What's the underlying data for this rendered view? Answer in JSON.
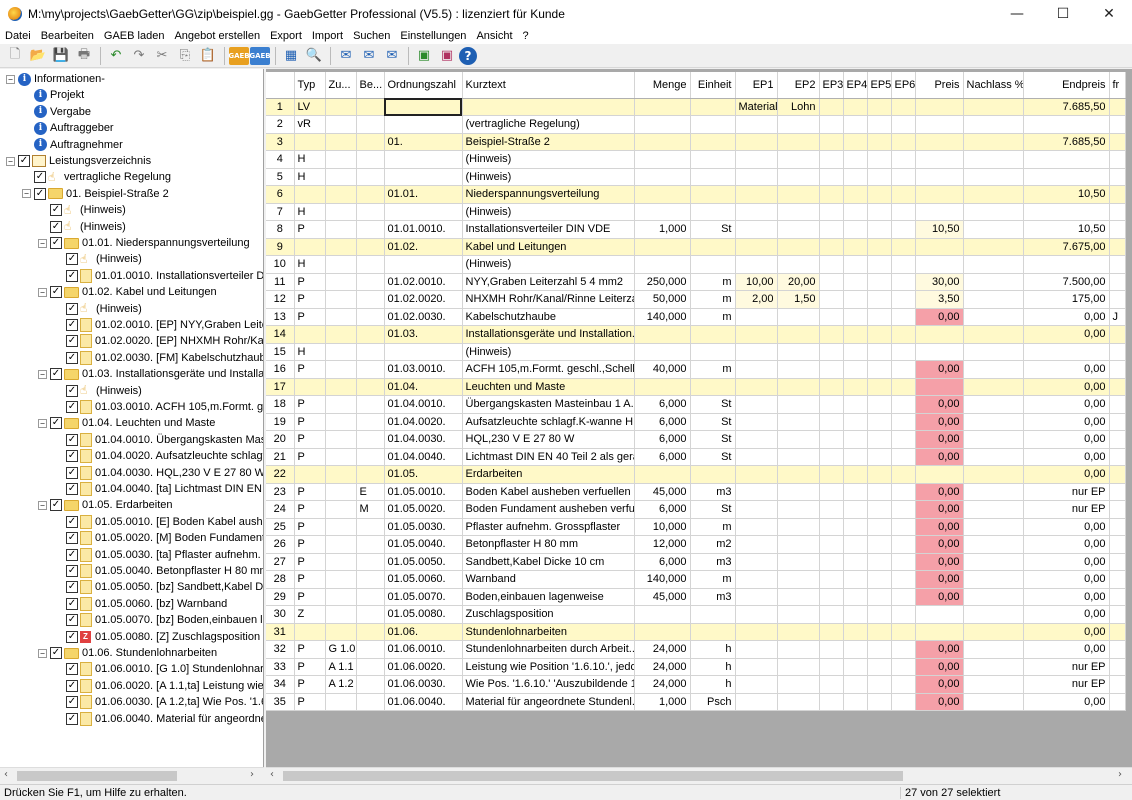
{
  "window": {
    "title": "M:\\my\\projects\\GaebGetter\\GG\\zip\\beispiel.gg - GaebGetter Professional (V5.5) : lizenziert für Kunde",
    "minimize": "—",
    "maximize": "☐",
    "close": "✕"
  },
  "menu": [
    "Datei",
    "Bearbeiten",
    "GAEB laden",
    "Angebot erstellen",
    "Export",
    "Import",
    "Suchen",
    "Einstellungen",
    "Ansicht",
    "?"
  ],
  "toolbar": {
    "icons": [
      "new-file-icon",
      "open-folder-icon",
      "save-icon",
      "print-icon",
      "undo-icon",
      "redo-icon",
      "cut-icon",
      "copy-icon",
      "paste-icon",
      "gaeb-import-icon",
      "gaeb-export-icon",
      "grid-view-icon",
      "search-icon",
      "mail-icon",
      "mail-export-icon",
      "mail-attach-icon",
      "calc-icon",
      "calc2-icon",
      "help-icon"
    ],
    "gaeb_label": "GAEB"
  },
  "tree": [
    {
      "level": 0,
      "exp": "−",
      "icon": "info",
      "label": "Informationen-"
    },
    {
      "level": 1,
      "icon": "info",
      "label": "Projekt"
    },
    {
      "level": 1,
      "icon": "info",
      "label": "Vergabe"
    },
    {
      "level": 1,
      "icon": "info",
      "label": "Auftraggeber"
    },
    {
      "level": 1,
      "icon": "info",
      "label": "Auftragnehmer"
    },
    {
      "level": 0,
      "exp": "−",
      "cb": true,
      "icon": "book",
      "label": "Leistungsverzeichnis"
    },
    {
      "level": 1,
      "cb": true,
      "icon": "hand",
      "label": "vertragliche Regelung"
    },
    {
      "level": 1,
      "exp": "−",
      "cb": true,
      "icon": "folder",
      "label": "01. Beispiel-Straße 2"
    },
    {
      "level": 2,
      "cb": true,
      "icon": "hand",
      "label": "(Hinweis)"
    },
    {
      "level": 2,
      "cb": true,
      "icon": "hand",
      "label": "(Hinweis)"
    },
    {
      "level": 2,
      "exp": "−",
      "cb": true,
      "icon": "folder",
      "label": "01.01. Niederspannungsverteilung"
    },
    {
      "level": 3,
      "cb": true,
      "icon": "hand",
      "label": "(Hinweis)"
    },
    {
      "level": 3,
      "cb": true,
      "icon": "doc",
      "label": "01.01.0010. Installationsverteiler DIN VDE"
    },
    {
      "level": 2,
      "exp": "−",
      "cb": true,
      "icon": "folder",
      "label": "01.02. Kabel und Leitungen"
    },
    {
      "level": 3,
      "cb": true,
      "icon": "hand",
      "label": "(Hinweis)"
    },
    {
      "level": 3,
      "cb": true,
      "icon": "doc",
      "label": "01.02.0010. [EP] NYY,Graben Leiterzahl"
    },
    {
      "level": 3,
      "cb": true,
      "icon": "doc",
      "label": "01.02.0020. [EP] NHXMH Rohr/Kanal"
    },
    {
      "level": 3,
      "cb": true,
      "icon": "doc",
      "label": "01.02.0030. [FM] Kabelschutzhaube"
    },
    {
      "level": 2,
      "exp": "−",
      "cb": true,
      "icon": "folder",
      "label": "01.03. Installationsgeräte und Installation"
    },
    {
      "level": 3,
      "cb": true,
      "icon": "hand",
      "label": "(Hinweis)"
    },
    {
      "level": 3,
      "cb": true,
      "icon": "doc",
      "label": "01.03.0010. ACFH 105,m.Formt. geschl."
    },
    {
      "level": 2,
      "exp": "−",
      "cb": true,
      "icon": "folder",
      "label": "01.04. Leuchten und Maste"
    },
    {
      "level": 3,
      "cb": true,
      "icon": "doc",
      "label": "01.04.0010. Übergangskasten Mastbau"
    },
    {
      "level": 3,
      "cb": true,
      "icon": "doc",
      "label": "01.04.0020. Aufsatzleuchte schlagf.K"
    },
    {
      "level": 3,
      "cb": true,
      "icon": "doc",
      "label": "01.04.0030. HQL,230 V E 27 80 W"
    },
    {
      "level": 3,
      "cb": true,
      "icon": "doc",
      "label": "01.04.0040. [ta] Lichtmast DIN EN 40"
    },
    {
      "level": 2,
      "exp": "−",
      "cb": true,
      "icon": "folder",
      "label": "01.05. Erdarbeiten"
    },
    {
      "level": 3,
      "cb": true,
      "icon": "doc",
      "label": "01.05.0010. [E] Boden Kabel ausheben"
    },
    {
      "level": 3,
      "cb": true,
      "icon": "doc",
      "label": "01.05.0020. [M] Boden Fundament aus"
    },
    {
      "level": 3,
      "cb": true,
      "icon": "doc",
      "label": "01.05.0030. [ta] Pflaster aufnehm. Gr"
    },
    {
      "level": 3,
      "cb": true,
      "icon": "doc",
      "label": "01.05.0040. Betonpflaster H 80 mm"
    },
    {
      "level": 3,
      "cb": true,
      "icon": "doc",
      "label": "01.05.0050. [bz] Sandbett,Kabel Dicke"
    },
    {
      "level": 3,
      "cb": true,
      "icon": "doc",
      "label": "01.05.0060. [bz] Warnband"
    },
    {
      "level": 3,
      "cb": true,
      "icon": "doc",
      "label": "01.05.0070. [bz] Boden,einbauen lag"
    },
    {
      "level": 3,
      "cb": true,
      "icon": "z",
      "label": "01.05.0080. [Z] Zuschlagsposition"
    },
    {
      "level": 2,
      "exp": "−",
      "cb": true,
      "icon": "folder",
      "label": "01.06. Stundenlohnarbeiten"
    },
    {
      "level": 3,
      "cb": true,
      "icon": "doc",
      "label": "01.06.0010. [G 1.0] Stundenlohnarbeiten"
    },
    {
      "level": 3,
      "cb": true,
      "icon": "doc",
      "label": "01.06.0020. [A 1.1,ta] Leistung wie P"
    },
    {
      "level": 3,
      "cb": true,
      "icon": "doc",
      "label": "01.06.0030. [A 1.2,ta] Wie Pos. '1.6.1"
    },
    {
      "level": 3,
      "cb": true,
      "icon": "doc",
      "label": "01.06.0040. Material für angeordnete"
    }
  ],
  "grid": {
    "columns": [
      "",
      "Typ",
      "Zu...",
      "Be...",
      "Ordnungszahl",
      "Kurztext",
      "Menge",
      "Einheit",
      "EP1",
      "EP2",
      "EP3",
      "EP4",
      "EP5",
      "EP6",
      "Preis",
      "Nachlass %",
      "Endpreis",
      "fr"
    ],
    "rows": [
      {
        "n": "1",
        "typ": "LV",
        "zu": "",
        "be": "",
        "oz": "",
        "kt": "",
        "menge": "",
        "einh": "",
        "ep1": "Material",
        "ep2": "Lohn",
        "preis": "",
        "end": "7.685,50",
        "group": true,
        "sel": true
      },
      {
        "n": "2",
        "typ": "vR",
        "zu": "",
        "be": "",
        "oz": "",
        "kt": "(vertragliche Regelung)",
        "menge": "",
        "einh": "",
        "ep1": "",
        "ep2": "",
        "preis": "",
        "end": ""
      },
      {
        "n": "3",
        "typ": "",
        "zu": "",
        "be": "",
        "oz": "01.",
        "kt": "Beispiel-Straße 2",
        "menge": "",
        "einh": "",
        "ep1": "",
        "ep2": "",
        "preis": "",
        "end": "7.685,50",
        "group": true
      },
      {
        "n": "4",
        "typ": "H",
        "zu": "",
        "be": "",
        "oz": "",
        "kt": "(Hinweis)",
        "menge": "",
        "einh": "",
        "ep1": "",
        "ep2": "",
        "preis": "",
        "end": ""
      },
      {
        "n": "5",
        "typ": "H",
        "zu": "",
        "be": "",
        "oz": "",
        "kt": "(Hinweis)",
        "menge": "",
        "einh": "",
        "ep1": "",
        "ep2": "",
        "preis": "",
        "end": ""
      },
      {
        "n": "6",
        "typ": "",
        "zu": "",
        "be": "",
        "oz": "01.01.",
        "kt": "Niederspannungsverteilung",
        "menge": "",
        "einh": "",
        "ep1": "",
        "ep2": "",
        "preis": "",
        "end": "10,50",
        "group": true
      },
      {
        "n": "7",
        "typ": "H",
        "zu": "",
        "be": "",
        "oz": "",
        "kt": "(Hinweis)",
        "menge": "",
        "einh": "",
        "ep1": "",
        "ep2": "",
        "preis": "",
        "end": ""
      },
      {
        "n": "8",
        "typ": "P",
        "zu": "",
        "be": "",
        "oz": "01.01.0010.",
        "kt": "Installationsverteiler DIN VDE",
        "menge": "1,000",
        "einh": "St",
        "ep1": "",
        "ep2": "",
        "preis": "10,50",
        "end": "10,50",
        "pale": true
      },
      {
        "n": "9",
        "typ": "",
        "zu": "",
        "be": "",
        "oz": "01.02.",
        "kt": "Kabel und Leitungen",
        "menge": "",
        "einh": "",
        "ep1": "",
        "ep2": "",
        "preis": "",
        "end": "7.675,00",
        "group": true
      },
      {
        "n": "10",
        "typ": "H",
        "zu": "",
        "be": "",
        "oz": "",
        "kt": "(Hinweis)",
        "menge": "",
        "einh": "",
        "ep1": "",
        "ep2": "",
        "preis": "",
        "end": ""
      },
      {
        "n": "11",
        "typ": "P",
        "zu": "",
        "be": "",
        "oz": "01.02.0010.",
        "kt": "NYY,Graben Leiterzahl 5 4 mm2",
        "menge": "250,000",
        "einh": "m",
        "ep1": "10,00",
        "ep2": "20,00",
        "preis": "30,00",
        "end": "7.500,00",
        "pale": true,
        "epale": true
      },
      {
        "n": "12",
        "typ": "P",
        "zu": "",
        "be": "",
        "oz": "01.02.0020.",
        "kt": "NHXMH Rohr/Kanal/Rinne Leiterza...",
        "menge": "50,000",
        "einh": "m",
        "ep1": "2,00",
        "ep2": "1,50",
        "preis": "3,50",
        "end": "175,00",
        "pale": true,
        "epale": true
      },
      {
        "n": "13",
        "typ": "P",
        "zu": "",
        "be": "",
        "oz": "01.02.0030.",
        "kt": "Kabelschutzhaube",
        "menge": "140,000",
        "einh": "m",
        "ep1": "",
        "ep2": "",
        "preis": "0,00",
        "end": "0,00",
        "pink": true,
        "fr": "J"
      },
      {
        "n": "14",
        "typ": "",
        "zu": "",
        "be": "",
        "oz": "01.03.",
        "kt": "Installationsgeräte und Installation...",
        "menge": "",
        "einh": "",
        "ep1": "",
        "ep2": "",
        "preis": "",
        "end": "0,00",
        "group": true
      },
      {
        "n": "15",
        "typ": "H",
        "zu": "",
        "be": "",
        "oz": "",
        "kt": "(Hinweis)",
        "menge": "",
        "einh": "",
        "ep1": "",
        "ep2": "",
        "preis": "",
        "end": ""
      },
      {
        "n": "16",
        "typ": "P",
        "zu": "",
        "be": "",
        "oz": "01.03.0010.",
        "kt": "ACFH 105,m.Formt. geschl.,Schelle...",
        "menge": "40,000",
        "einh": "m",
        "ep1": "",
        "ep2": "",
        "preis": "0,00",
        "end": "0,00",
        "pink": true
      },
      {
        "n": "17",
        "typ": "",
        "zu": "",
        "be": "",
        "oz": "01.04.",
        "kt": "Leuchten und Maste",
        "menge": "",
        "einh": "",
        "ep1": "",
        "ep2": "",
        "preis": "",
        "end": "0,00",
        "group": true,
        "pink": true
      },
      {
        "n": "18",
        "typ": "P",
        "zu": "",
        "be": "",
        "oz": "01.04.0010.",
        "kt": "Übergangskasten Masteinbau 1 A...",
        "menge": "6,000",
        "einh": "St",
        "ep1": "",
        "ep2": "",
        "preis": "0,00",
        "end": "0,00",
        "pink": true
      },
      {
        "n": "19",
        "typ": "P",
        "zu": "",
        "be": "",
        "oz": "01.04.0020.",
        "kt": "Aufsatzleuchte schlagf.K-wanne H...",
        "menge": "6,000",
        "einh": "St",
        "ep1": "",
        "ep2": "",
        "preis": "0,00",
        "end": "0,00",
        "pink": true
      },
      {
        "n": "20",
        "typ": "P",
        "zu": "",
        "be": "",
        "oz": "01.04.0030.",
        "kt": "HQL,230 V E 27 80 W",
        "menge": "6,000",
        "einh": "St",
        "ep1": "",
        "ep2": "",
        "preis": "0,00",
        "end": "0,00",
        "pink": true
      },
      {
        "n": "21",
        "typ": "P",
        "zu": "",
        "be": "",
        "oz": "01.04.0040.",
        "kt": "Lichtmast DIN EN 40 Teil 2 als gera...",
        "menge": "6,000",
        "einh": "St",
        "ep1": "",
        "ep2": "",
        "preis": "0,00",
        "end": "0,00",
        "pink": true
      },
      {
        "n": "22",
        "typ": "",
        "zu": "",
        "be": "",
        "oz": "01.05.",
        "kt": "Erdarbeiten",
        "menge": "",
        "einh": "",
        "ep1": "",
        "ep2": "",
        "preis": "",
        "end": "0,00",
        "group": true
      },
      {
        "n": "23",
        "typ": "P",
        "zu": "",
        "be": "E",
        "oz": "01.05.0010.",
        "kt": "Boden Kabel ausheben verfuellen",
        "menge": "45,000",
        "einh": "m3",
        "ep1": "",
        "ep2": "",
        "preis": "0,00",
        "end": "nur EP",
        "pink": true
      },
      {
        "n": "24",
        "typ": "P",
        "zu": "",
        "be": "M",
        "oz": "01.05.0020.",
        "kt": "Boden Fundament ausheben verfu...",
        "menge": "6,000",
        "einh": "St",
        "ep1": "",
        "ep2": "",
        "preis": "0,00",
        "end": "nur EP",
        "pink": true
      },
      {
        "n": "25",
        "typ": "P",
        "zu": "",
        "be": "",
        "oz": "01.05.0030.",
        "kt": "Pflaster aufnehm. Grosspflaster",
        "menge": "10,000",
        "einh": "m",
        "ep1": "",
        "ep2": "",
        "preis": "0,00",
        "end": "0,00",
        "pink": true
      },
      {
        "n": "26",
        "typ": "P",
        "zu": "",
        "be": "",
        "oz": "01.05.0040.",
        "kt": "Betonpflaster H 80 mm",
        "menge": "12,000",
        "einh": "m2",
        "ep1": "",
        "ep2": "",
        "preis": "0,00",
        "end": "0,00",
        "pink": true
      },
      {
        "n": "27",
        "typ": "P",
        "zu": "",
        "be": "",
        "oz": "01.05.0050.",
        "kt": "Sandbett,Kabel Dicke 10 cm",
        "menge": "6,000",
        "einh": "m3",
        "ep1": "",
        "ep2": "",
        "preis": "0,00",
        "end": "0,00",
        "pink": true
      },
      {
        "n": "28",
        "typ": "P",
        "zu": "",
        "be": "",
        "oz": "01.05.0060.",
        "kt": "Warnband",
        "menge": "140,000",
        "einh": "m",
        "ep1": "",
        "ep2": "",
        "preis": "0,00",
        "end": "0,00",
        "pink": true
      },
      {
        "n": "29",
        "typ": "P",
        "zu": "",
        "be": "",
        "oz": "01.05.0070.",
        "kt": "Boden,einbauen lagenweise",
        "menge": "45,000",
        "einh": "m3",
        "ep1": "",
        "ep2": "",
        "preis": "0,00",
        "end": "0,00",
        "pink": true
      },
      {
        "n": "30",
        "typ": "Z",
        "zu": "",
        "be": "",
        "oz": "01.05.0080.",
        "kt": "Zuschlagsposition",
        "menge": "",
        "einh": "",
        "ep1": "",
        "ep2": "",
        "preis": "",
        "end": "0,00"
      },
      {
        "n": "31",
        "typ": "",
        "zu": "",
        "be": "",
        "oz": "01.06.",
        "kt": "Stundenlohnarbeiten",
        "menge": "",
        "einh": "",
        "ep1": "",
        "ep2": "",
        "preis": "",
        "end": "0,00",
        "group": true
      },
      {
        "n": "32",
        "typ": "P",
        "zu": "G 1.0",
        "be": "",
        "oz": "01.06.0010.",
        "kt": "Stundenlohnarbeiten durch Arbeit...",
        "menge": "24,000",
        "einh": "h",
        "ep1": "",
        "ep2": "",
        "preis": "0,00",
        "end": "0,00",
        "pink": true
      },
      {
        "n": "33",
        "typ": "P",
        "zu": "A 1.1",
        "be": "",
        "oz": "01.06.0020.",
        "kt": "Leistung wie Position '1.6.10.', jedo...",
        "menge": "24,000",
        "einh": "h",
        "ep1": "",
        "ep2": "",
        "preis": "0,00",
        "end": "nur EP",
        "pink": true
      },
      {
        "n": "34",
        "typ": "P",
        "zu": "A 1.2",
        "be": "",
        "oz": "01.06.0030.",
        "kt": "Wie Pos. '1.6.10.' 'Auszubildende 1...",
        "menge": "24,000",
        "einh": "h",
        "ep1": "",
        "ep2": "",
        "preis": "0,00",
        "end": "nur EP",
        "pink": true
      },
      {
        "n": "35",
        "typ": "P",
        "zu": "",
        "be": "",
        "oz": "01.06.0040.",
        "kt": "Material für angeordnete Stundenl...",
        "menge": "1,000",
        "einh": "Psch",
        "ep1": "",
        "ep2": "",
        "preis": "0,00",
        "end": "0,00",
        "pink": true
      }
    ]
  },
  "status": {
    "left": "Drücken Sie F1, um Hilfe zu erhalten.",
    "right": "27 von 27 selektiert"
  }
}
